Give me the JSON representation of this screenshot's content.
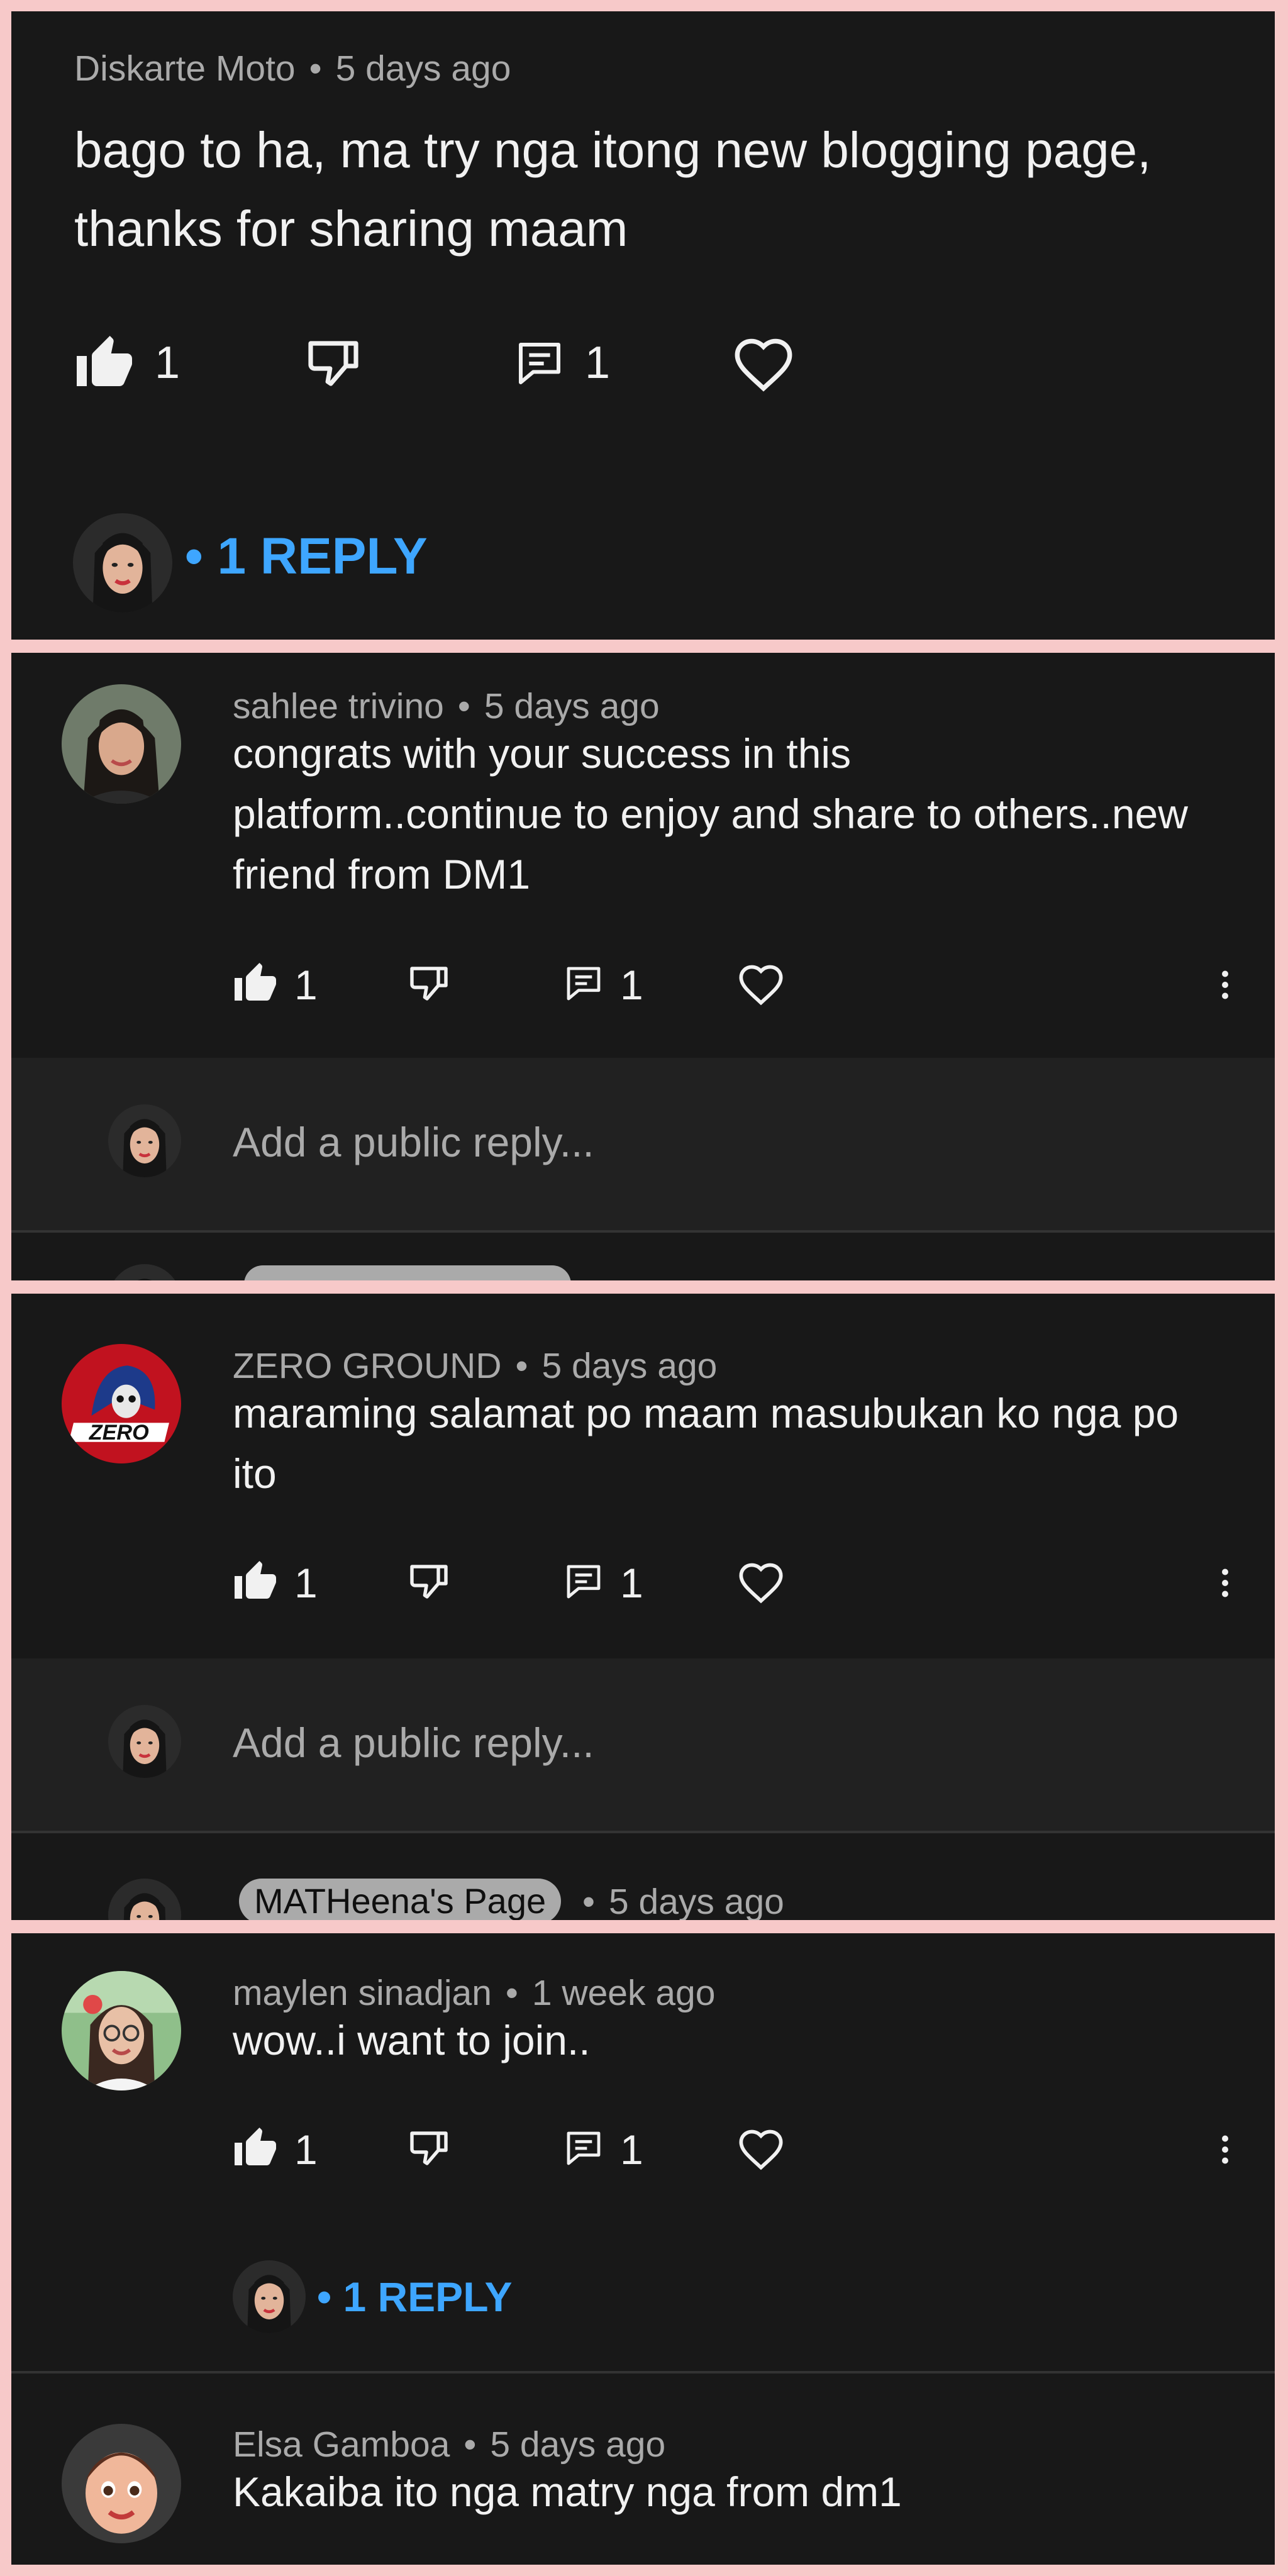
{
  "colors": {
    "background": "#181818",
    "frame": "#f7c9c9",
    "text_primary": "#f1f1f1",
    "text_secondary": "#aaaaaa",
    "link": "#3ea6ff",
    "reply_box": "#212121"
  },
  "separator": "•",
  "comments": [
    {
      "author": "Diskarte Moto",
      "time": "5 days ago",
      "lines": [
        "bago to ha, ma try nga itong new blogging page,",
        "thanks for sharing maam"
      ],
      "likes": "1",
      "replies": "1",
      "reply_link": "• 1 REPLY"
    },
    {
      "author": "sahlee trivino",
      "time": "5 days ago",
      "lines": [
        "congrats with your success in this",
        "platform..continue to enjoy and share to others..new",
        "friend from DM1"
      ],
      "likes": "1",
      "replies": "1",
      "reply_placeholder": "Add a public reply..."
    },
    {
      "author": "ZERO GROUND",
      "time": "5 days ago",
      "lines": [
        "maraming salamat po maam masubukan ko nga po",
        "ito"
      ],
      "likes": "1",
      "replies": "1",
      "reply_placeholder": "Add a public reply...",
      "next_reply": {
        "author_badge": "MATHeena's Page",
        "time": "5 days ago"
      }
    },
    {
      "author": "maylen sinadjan",
      "time": "1 week ago",
      "lines": [
        "wow..i want to join.."
      ],
      "likes": "1",
      "replies": "1",
      "reply_link": "• 1 REPLY"
    },
    {
      "author": "Elsa Gamboa",
      "time": "5 days ago",
      "lines": [
        "Kakaiba ito nga matry nga from dm1"
      ]
    }
  ],
  "icons": [
    "like-icon",
    "dislike-icon",
    "reply-icon",
    "heart-icon",
    "more-vert-icon"
  ]
}
